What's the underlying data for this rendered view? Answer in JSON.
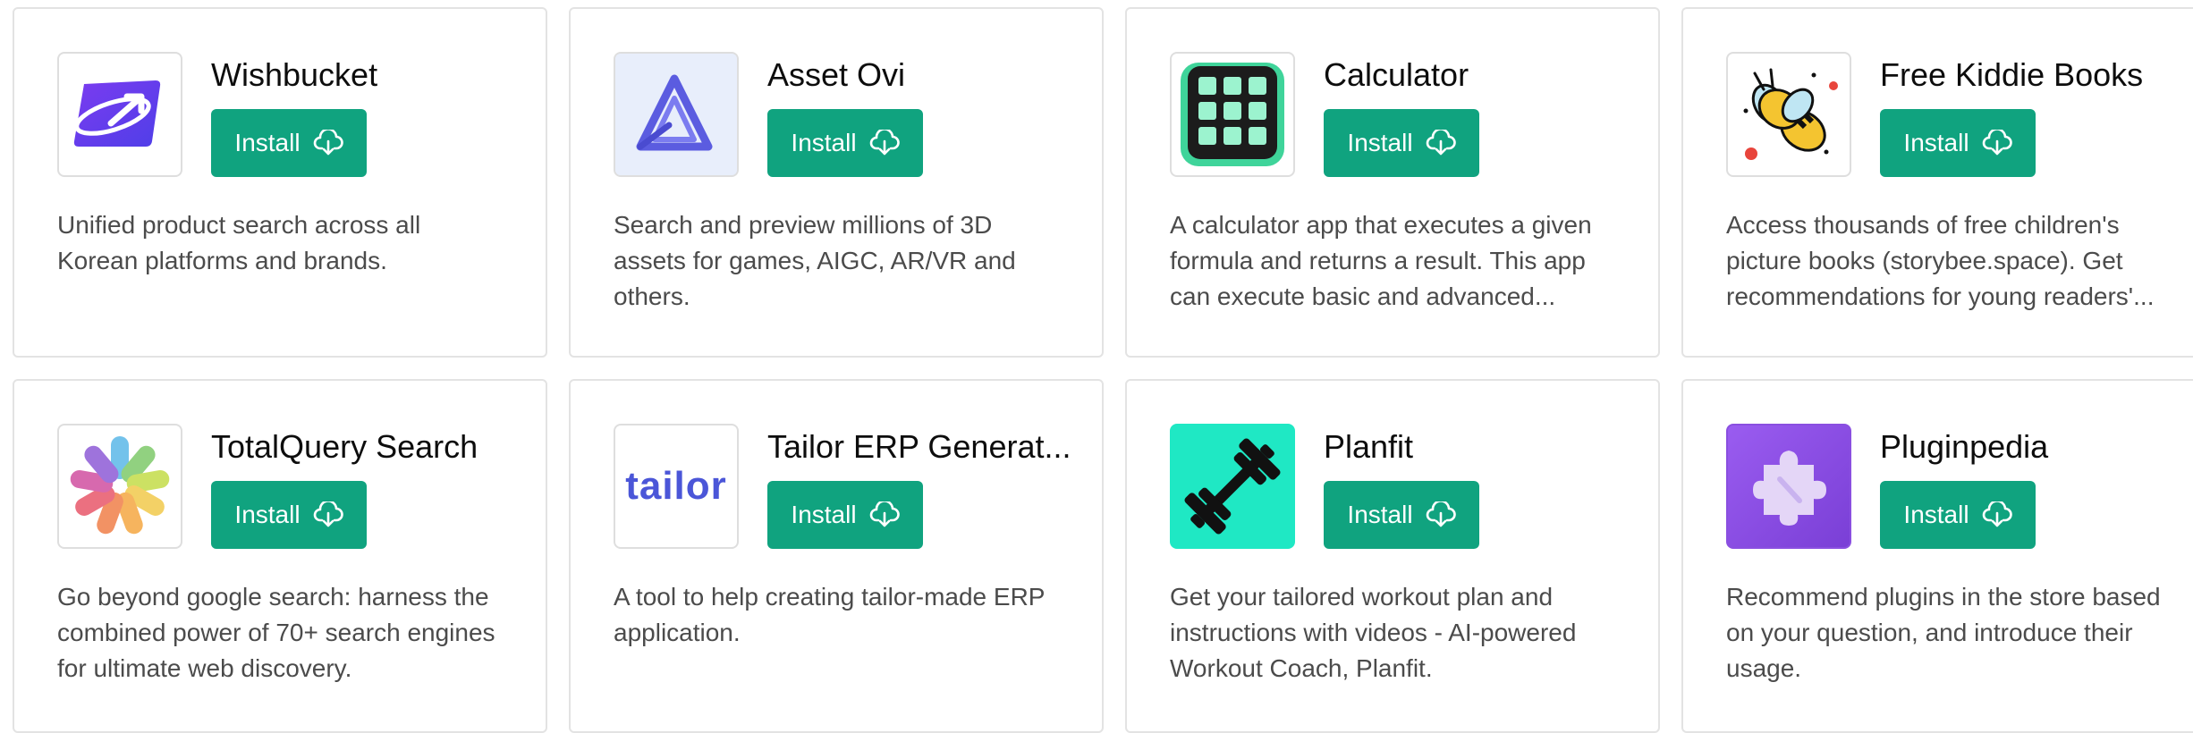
{
  "colors": {
    "install_bg": "#10a37f",
    "install_text": "#ffffff",
    "card_border": "#e3e3e3",
    "description_text": "#4b4b4b"
  },
  "plugins": [
    {
      "name": "Wishbucket",
      "icon": "wishbucket-logo-icon",
      "install_label": "Install",
      "description_lines": [
        "Unified product search across all",
        "Korean platforms and brands."
      ]
    },
    {
      "name": "Asset Ovi",
      "icon": "asset-ovi-logo-icon",
      "install_label": "Install",
      "description_lines": [
        "Search and preview millions of 3D",
        "assets for games, AIGC, AR/VR and",
        "others."
      ]
    },
    {
      "name": "Calculator",
      "icon": "calculator-logo-icon",
      "install_label": "Install",
      "description_lines": [
        "A calculator app that executes a given",
        "formula and returns a result. This app",
        "can execute basic and advanced..."
      ]
    },
    {
      "name": "Free Kiddie Books",
      "icon": "bee-logo-icon",
      "install_label": "Install",
      "description_lines": [
        "Access thousands of free children's",
        "picture books (storybee.space). Get",
        "recommendations for young readers'..."
      ]
    },
    {
      "name": "TotalQuery Search",
      "icon": "totalquery-flower-logo-icon",
      "install_label": "Install",
      "description_lines": [
        "Go beyond google search: harness the",
        "combined power of 70+ search engines",
        "for ultimate web discovery."
      ]
    },
    {
      "name": "Tailor ERP Generat...",
      "icon": "tailor-wordmark-logo-icon",
      "logo_text": "tailor",
      "install_label": "Install",
      "description_lines": [
        "A tool to help creating tailor-made ERP",
        "application."
      ]
    },
    {
      "name": "Planfit",
      "icon": "dumbbell-logo-icon",
      "install_label": "Install",
      "description_lines": [
        "Get your tailored workout plan and",
        "instructions with videos - AI-powered",
        "Workout Coach, Planfit."
      ]
    },
    {
      "name": "Pluginpedia",
      "icon": "puzzle-piece-logo-icon",
      "install_label": "Install",
      "description_lines": [
        "Recommend plugins in the store based",
        "on your question, and introduce their",
        "usage."
      ]
    }
  ]
}
